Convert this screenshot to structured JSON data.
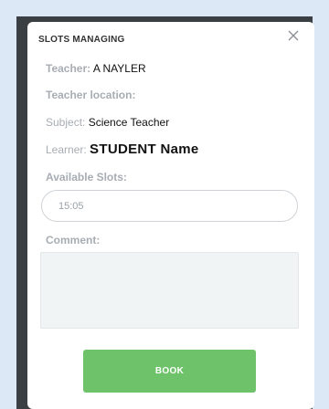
{
  "modal": {
    "title": "SLOTS MANAGING",
    "close_icon": "close-icon"
  },
  "teacher": {
    "label": "Teacher:",
    "value": "A NAYLER"
  },
  "teacher_location": {
    "label": "Teacher location:",
    "value": ""
  },
  "subject": {
    "label": "Subject:",
    "value": "Science Teacher"
  },
  "learner": {
    "label": "Learner:",
    "value": "STUDENT Name"
  },
  "available_slots": {
    "label": "Available Slots:",
    "selected": "15:05"
  },
  "comment": {
    "label": "Comment:",
    "value": ""
  },
  "actions": {
    "book_label": "BOOK"
  },
  "colors": {
    "page_background": "#dde8f7",
    "overlay": "#3a3f44",
    "label": "#a8adb3",
    "book_button": "#6dc26a",
    "comment_background": "#f1f4f4"
  }
}
